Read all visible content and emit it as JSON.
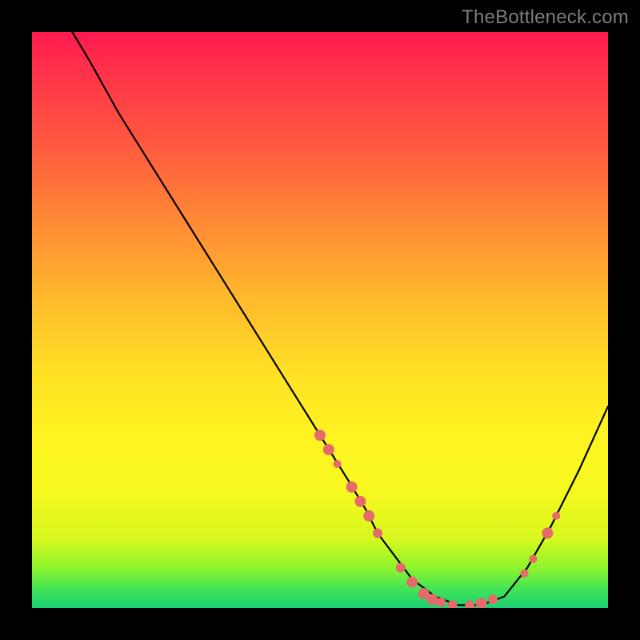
{
  "attribution": "TheBottleneck.com",
  "colors": {
    "background": "#000000",
    "curve": "#000000",
    "marker": "#e56a6a",
    "gradient_top": "#ff1a4f",
    "gradient_bottom": "#1bd074"
  },
  "chart_data": {
    "type": "line",
    "title": "",
    "xlabel": "",
    "ylabel": "",
    "xlim": [
      0,
      100
    ],
    "ylim": [
      0,
      100
    ],
    "note": "V-shaped bottleneck curve. y is read as fraction of plot height from bottom (0=bottom, 100=top). x is fraction of plot width from left.",
    "series": [
      {
        "name": "bottleneck-curve",
        "x": [
          7,
          10,
          15,
          20,
          25,
          30,
          35,
          40,
          45,
          50,
          55,
          58,
          60,
          63,
          66,
          70,
          74,
          78,
          82,
          86,
          90,
          95,
          100
        ],
        "y": [
          100,
          95,
          86,
          78,
          70,
          62,
          54,
          46,
          38,
          30,
          22,
          17,
          13,
          9,
          5,
          2,
          0.5,
          0.5,
          2,
          7,
          14,
          24,
          35
        ]
      }
    ],
    "markers": {
      "note": "Salmon dot markers overlaid on the curve.",
      "radius_small": 5,
      "radius_large": 7,
      "points": [
        {
          "x": 50,
          "y": 30,
          "r": 7
        },
        {
          "x": 51.5,
          "y": 27.5,
          "r": 7
        },
        {
          "x": 53,
          "y": 25,
          "r": 5
        },
        {
          "x": 55.5,
          "y": 21,
          "r": 7
        },
        {
          "x": 57,
          "y": 18.5,
          "r": 7
        },
        {
          "x": 58.5,
          "y": 16,
          "r": 7
        },
        {
          "x": 60,
          "y": 13,
          "r": 6
        },
        {
          "x": 64,
          "y": 7,
          "r": 6
        },
        {
          "x": 66,
          "y": 4.5,
          "r": 7
        },
        {
          "x": 68,
          "y": 2.5,
          "r": 7
        },
        {
          "x": 69.5,
          "y": 1.5,
          "r": 7
        },
        {
          "x": 71,
          "y": 1,
          "r": 6
        },
        {
          "x": 73,
          "y": 0.5,
          "r": 6
        },
        {
          "x": 76,
          "y": 0.5,
          "r": 6
        },
        {
          "x": 78,
          "y": 0.8,
          "r": 7
        },
        {
          "x": 80,
          "y": 1.5,
          "r": 6
        },
        {
          "x": 85.5,
          "y": 6,
          "r": 5
        },
        {
          "x": 87,
          "y": 8.5,
          "r": 5
        },
        {
          "x": 89.5,
          "y": 13,
          "r": 7
        },
        {
          "x": 91,
          "y": 16,
          "r": 5
        }
      ]
    }
  }
}
